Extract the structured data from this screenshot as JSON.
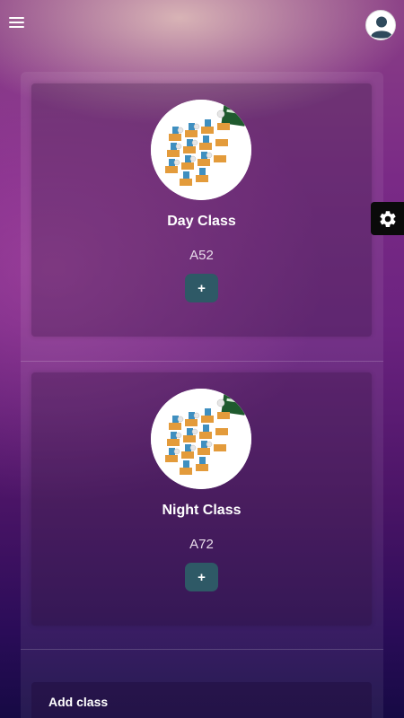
{
  "app": {
    "menu_icon": "hamburger-menu-icon",
    "profile_icon": "user-avatar-icon",
    "settings_icon": "gear-icon"
  },
  "classes": [
    {
      "title": "Day Class",
      "code": "A52",
      "add_label": "+",
      "image": "classroom-illustration"
    },
    {
      "title": "Night Class",
      "code": "A72",
      "add_label": "+",
      "image": "classroom-illustration"
    }
  ],
  "add_class": {
    "label": "Add class"
  },
  "colors": {
    "accent_button": "#2e5966",
    "background_top": "#8a3f86",
    "background_bottom": "#160a44",
    "settings_tab": "#0a0a0a"
  }
}
